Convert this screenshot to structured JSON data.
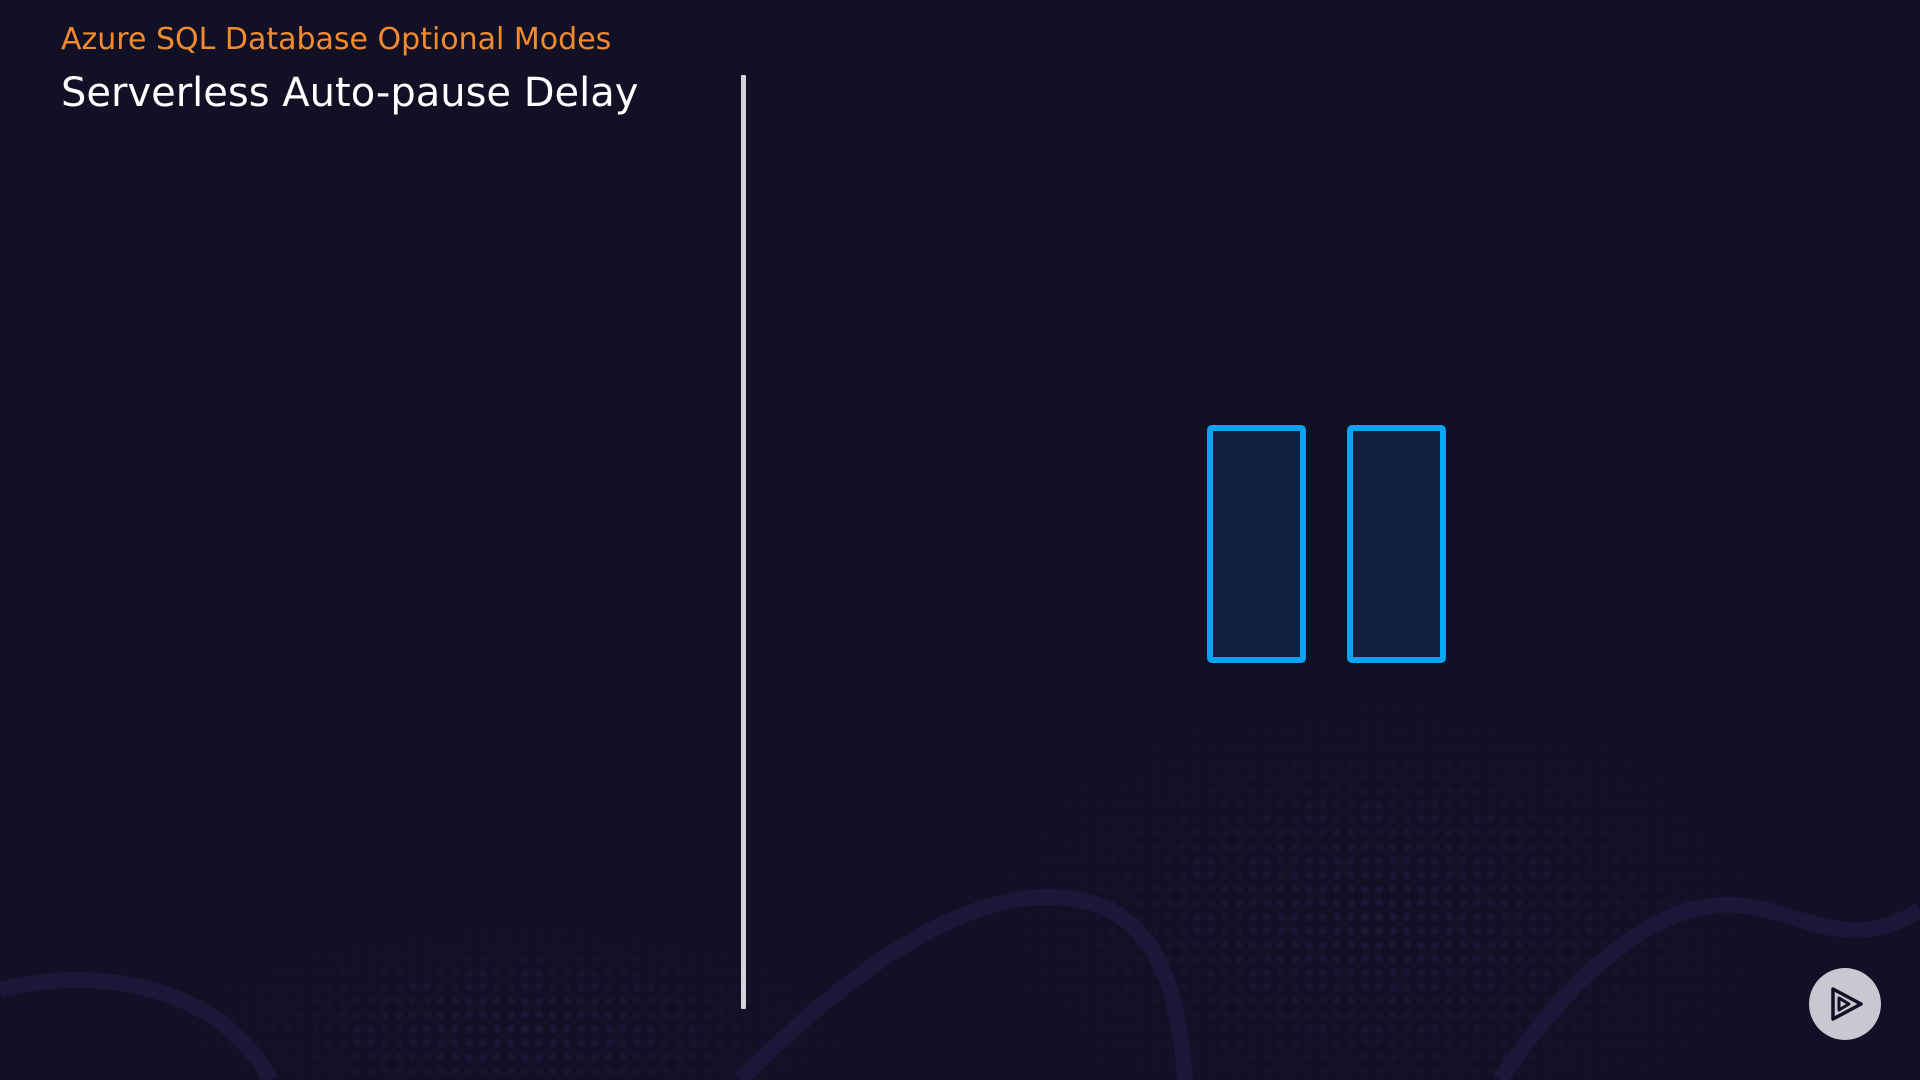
{
  "slide": {
    "section_title": "Azure SQL Database Optional Modes",
    "title": "Serverless Auto-pause Delay"
  },
  "graphic": {
    "icon": "pause-icon",
    "accent_color": "#0ca3f2",
    "fill_color": "#10203f"
  },
  "player": {
    "icon": "play-logo-icon"
  },
  "colors": {
    "background": "#121024",
    "section_title": "#f28a2e",
    "title": "#ffffff",
    "divider": "#d4d3dc"
  }
}
